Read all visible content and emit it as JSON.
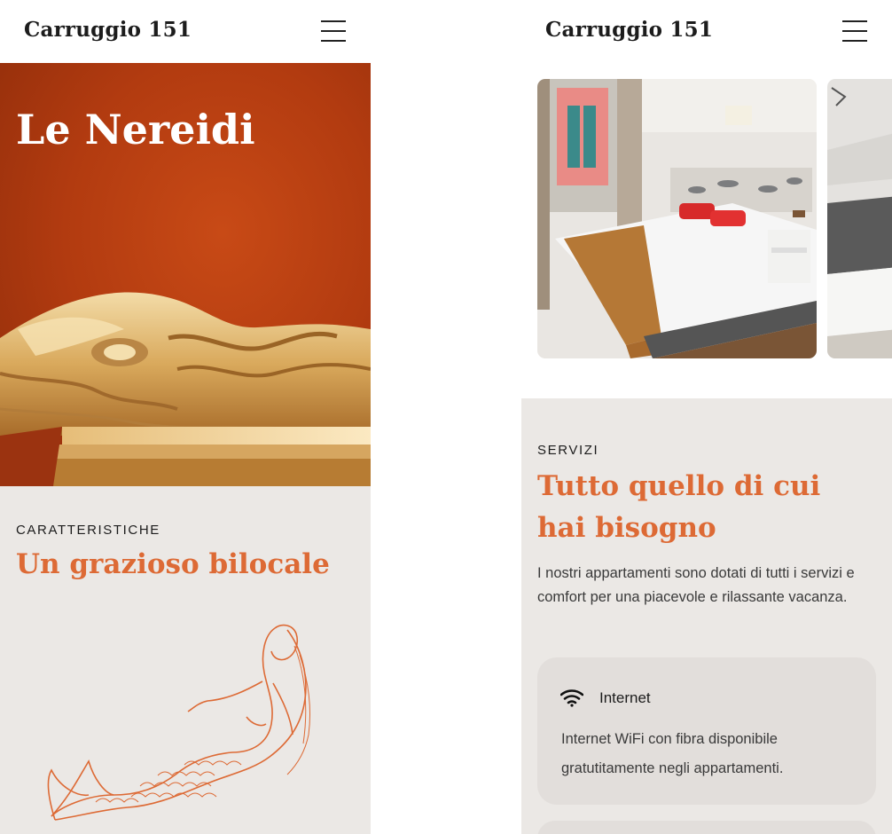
{
  "left_screen": {
    "header": {
      "logo": "Carruggio 151",
      "menu_icon": "hamburger-menu-icon"
    },
    "hero": {
      "title": "Le Nereidi"
    },
    "features": {
      "eyebrow": "CARATTERISTICHE",
      "title": "Un grazioso bilocale"
    }
  },
  "right_screen": {
    "header": {
      "logo": "Carruggio 151",
      "menu_icon": "hamburger-menu-icon"
    },
    "services": {
      "eyebrow": "SERVIZI",
      "title_line1": "Tutto quello di cui",
      "title_line2": "hai bisogno",
      "description": "I nostri appartamenti sono dotati di tutti i servizi e comfort per una piacevole e rilassante vacanza.",
      "cards": [
        {
          "icon": "wifi-icon",
          "title": "Internet",
          "text": "Internet WiFi con fibra disponibile gratutitamente negli appartamenti."
        }
      ]
    }
  },
  "colors": {
    "accent": "#dd6a35",
    "hero_red": "#b23b10",
    "section_bg": "#ebe8e5",
    "card_bg": "#e2dedb"
  }
}
